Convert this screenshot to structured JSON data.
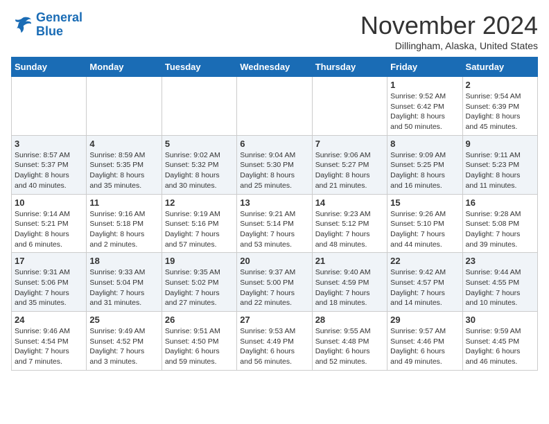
{
  "logo": {
    "line1": "General",
    "line2": "Blue"
  },
  "title": "November 2024",
  "subtitle": "Dillingham, Alaska, United States",
  "headers": [
    "Sunday",
    "Monday",
    "Tuesday",
    "Wednesday",
    "Thursday",
    "Friday",
    "Saturday"
  ],
  "weeks": [
    [
      {
        "day": "",
        "info": ""
      },
      {
        "day": "",
        "info": ""
      },
      {
        "day": "",
        "info": ""
      },
      {
        "day": "",
        "info": ""
      },
      {
        "day": "",
        "info": ""
      },
      {
        "day": "1",
        "info": "Sunrise: 9:52 AM\nSunset: 6:42 PM\nDaylight: 8 hours\nand 50 minutes."
      },
      {
        "day": "2",
        "info": "Sunrise: 9:54 AM\nSunset: 6:39 PM\nDaylight: 8 hours\nand 45 minutes."
      }
    ],
    [
      {
        "day": "3",
        "info": "Sunrise: 8:57 AM\nSunset: 5:37 PM\nDaylight: 8 hours\nand 40 minutes."
      },
      {
        "day": "4",
        "info": "Sunrise: 8:59 AM\nSunset: 5:35 PM\nDaylight: 8 hours\nand 35 minutes."
      },
      {
        "day": "5",
        "info": "Sunrise: 9:02 AM\nSunset: 5:32 PM\nDaylight: 8 hours\nand 30 minutes."
      },
      {
        "day": "6",
        "info": "Sunrise: 9:04 AM\nSunset: 5:30 PM\nDaylight: 8 hours\nand 25 minutes."
      },
      {
        "day": "7",
        "info": "Sunrise: 9:06 AM\nSunset: 5:27 PM\nDaylight: 8 hours\nand 21 minutes."
      },
      {
        "day": "8",
        "info": "Sunrise: 9:09 AM\nSunset: 5:25 PM\nDaylight: 8 hours\nand 16 minutes."
      },
      {
        "day": "9",
        "info": "Sunrise: 9:11 AM\nSunset: 5:23 PM\nDaylight: 8 hours\nand 11 minutes."
      }
    ],
    [
      {
        "day": "10",
        "info": "Sunrise: 9:14 AM\nSunset: 5:21 PM\nDaylight: 8 hours\nand 6 minutes."
      },
      {
        "day": "11",
        "info": "Sunrise: 9:16 AM\nSunset: 5:18 PM\nDaylight: 8 hours\nand 2 minutes."
      },
      {
        "day": "12",
        "info": "Sunrise: 9:19 AM\nSunset: 5:16 PM\nDaylight: 7 hours\nand 57 minutes."
      },
      {
        "day": "13",
        "info": "Sunrise: 9:21 AM\nSunset: 5:14 PM\nDaylight: 7 hours\nand 53 minutes."
      },
      {
        "day": "14",
        "info": "Sunrise: 9:23 AM\nSunset: 5:12 PM\nDaylight: 7 hours\nand 48 minutes."
      },
      {
        "day": "15",
        "info": "Sunrise: 9:26 AM\nSunset: 5:10 PM\nDaylight: 7 hours\nand 44 minutes."
      },
      {
        "day": "16",
        "info": "Sunrise: 9:28 AM\nSunset: 5:08 PM\nDaylight: 7 hours\nand 39 minutes."
      }
    ],
    [
      {
        "day": "17",
        "info": "Sunrise: 9:31 AM\nSunset: 5:06 PM\nDaylight: 7 hours\nand 35 minutes."
      },
      {
        "day": "18",
        "info": "Sunrise: 9:33 AM\nSunset: 5:04 PM\nDaylight: 7 hours\nand 31 minutes."
      },
      {
        "day": "19",
        "info": "Sunrise: 9:35 AM\nSunset: 5:02 PM\nDaylight: 7 hours\nand 27 minutes."
      },
      {
        "day": "20",
        "info": "Sunrise: 9:37 AM\nSunset: 5:00 PM\nDaylight: 7 hours\nand 22 minutes."
      },
      {
        "day": "21",
        "info": "Sunrise: 9:40 AM\nSunset: 4:59 PM\nDaylight: 7 hours\nand 18 minutes."
      },
      {
        "day": "22",
        "info": "Sunrise: 9:42 AM\nSunset: 4:57 PM\nDaylight: 7 hours\nand 14 minutes."
      },
      {
        "day": "23",
        "info": "Sunrise: 9:44 AM\nSunset: 4:55 PM\nDaylight: 7 hours\nand 10 minutes."
      }
    ],
    [
      {
        "day": "24",
        "info": "Sunrise: 9:46 AM\nSunset: 4:54 PM\nDaylight: 7 hours\nand 7 minutes."
      },
      {
        "day": "25",
        "info": "Sunrise: 9:49 AM\nSunset: 4:52 PM\nDaylight: 7 hours\nand 3 minutes."
      },
      {
        "day": "26",
        "info": "Sunrise: 9:51 AM\nSunset: 4:50 PM\nDaylight: 6 hours\nand 59 minutes."
      },
      {
        "day": "27",
        "info": "Sunrise: 9:53 AM\nSunset: 4:49 PM\nDaylight: 6 hours\nand 56 minutes."
      },
      {
        "day": "28",
        "info": "Sunrise: 9:55 AM\nSunset: 4:48 PM\nDaylight: 6 hours\nand 52 minutes."
      },
      {
        "day": "29",
        "info": "Sunrise: 9:57 AM\nSunset: 4:46 PM\nDaylight: 6 hours\nand 49 minutes."
      },
      {
        "day": "30",
        "info": "Sunrise: 9:59 AM\nSunset: 4:45 PM\nDaylight: 6 hours\nand 46 minutes."
      }
    ]
  ]
}
